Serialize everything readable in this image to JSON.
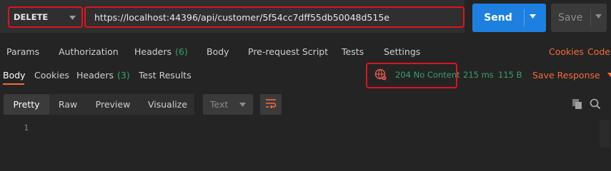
{
  "request": {
    "method": "DELETE",
    "url": "https://localhost:44396/api/customer/5f54cc7dff55db50048d515e",
    "send_label": "Send",
    "save_label": "Save"
  },
  "request_tabs": {
    "params": "Params",
    "authorization": "Authorization",
    "headers": "Headers",
    "headers_count": "(6)",
    "body": "Body",
    "pre_request": "Pre-request Script",
    "tests": "Tests",
    "settings": "Settings",
    "cookies": "Cookies",
    "code": "Code"
  },
  "response_tabs": {
    "body": "Body",
    "cookies": "Cookies",
    "headers": "Headers",
    "headers_count": "(3)",
    "test_results": "Test Results"
  },
  "response_status": {
    "status": "204 No Content",
    "time": "215 ms",
    "size": "115 B",
    "save_response": "Save Response"
  },
  "format_toolbar": {
    "pretty": "Pretty",
    "raw": "Raw",
    "preview": "Preview",
    "visualize": "Visualize",
    "type": "Text"
  },
  "editor": {
    "line_number": "1"
  },
  "colors": {
    "accent_orange": "#f26b3a",
    "send_blue": "#1d80e0",
    "status_green": "#38a169",
    "highlight_red": "#e0131f"
  },
  "icons": [
    "chevron-down-icon",
    "globe-icon",
    "wrap-lines-icon",
    "copy-icon",
    "search-icon"
  ]
}
